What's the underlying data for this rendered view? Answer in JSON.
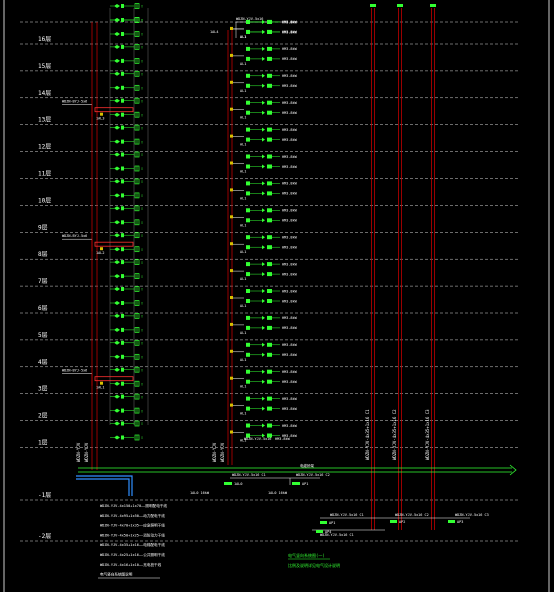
{
  "floors": [
    "16层",
    "15层",
    "14层",
    "13层",
    "12层",
    "11层",
    "10层",
    "9层",
    "8层",
    "7层",
    "6层",
    "5层",
    "4层",
    "3层",
    "2层",
    "1层"
  ],
  "basement_floors": [
    "-1层",
    "-2层"
  ],
  "left_riser_feeders": [
    {
      "floor_index": 3,
      "text": "WDZN-BYJ-5x6",
      "box": "1AL3"
    },
    {
      "floor_index": 8,
      "text": "WDZN-BYJ-5x6",
      "box": "1AL2"
    },
    {
      "floor_index": 13,
      "text": "WDZN-BYJ-5x6",
      "box": "1AL1"
    }
  ],
  "middle_riser": {
    "top_label": "WDZN-YJV-5x16",
    "top_box": "1AL4",
    "box_label": "AL1",
    "meter_label": "HM3.8kW",
    "bottom_label": "WDZN-YJV-5x16",
    "bottom_note": "HM3.8kW"
  },
  "right_riser_labels": [
    "WDZN-YJV-4x35+1x16 C1",
    "WDZN-YJV-4x35+1x16 C2",
    "WDZN-YJV-4x35+1x16 C3"
  ],
  "left_feeder_labels": [
    "WDZN-YJV",
    "WDZN-YJV"
  ],
  "mid_feeder_labels": [
    "WDZN-YJV",
    "WDZN-YJV"
  ],
  "busbar_label": "电缆桥架",
  "basement": {
    "cable_labels": [
      "WDZN-YJV-5x16 C1",
      "WDZN-YJV-5x16 C2"
    ],
    "box_labels": [
      "1AL0",
      "AP1"
    ],
    "left_note": "1AL0 16kW",
    "mid_note": "1AL0 16kW",
    "right_cables": [
      "WDZN-YJV-5x16 C1",
      "WDZN-YJV-5x16 C2",
      "WDZN-YJV-5x16 C3"
    ],
    "right_boxes": [
      "AP1",
      "AP2",
      "AP3",
      "AP4"
    ]
  },
  "legend_lines": [
    "WDZN-YJV-4x150+1x70——照明配电干线",
    "WDZN-YJV-4x95+1x50——动力配电干线",
    "WDZN-YJV-4x70+1x35——应急照明干线",
    "WDZN-YJV-4x50+1x25——消防动力干线",
    "WDZN-YJV-4x35+1x16——电梯配电干线",
    "WDZN-YJV-4x25+1x16——公共照明干线",
    "WDZN-YJV-4x16+1x10——充电桩干线",
    "电气竖向系统图说明"
  ],
  "title_block": [
    "电气竖向系统图(一)",
    "比例及说明详见电气设计说明"
  ],
  "colors": {
    "floor_line": "#d8d8d8",
    "riser": "#c00000",
    "device": "#33ff33",
    "busbar": "#33ff33",
    "text": "#ffffff",
    "yellow": "#d8c000",
    "blue": "#3090ff",
    "red_box": "#ff3030"
  },
  "icons": [
    "meter-box-icon",
    "distribution-box-icon",
    "breaker-icon"
  ]
}
